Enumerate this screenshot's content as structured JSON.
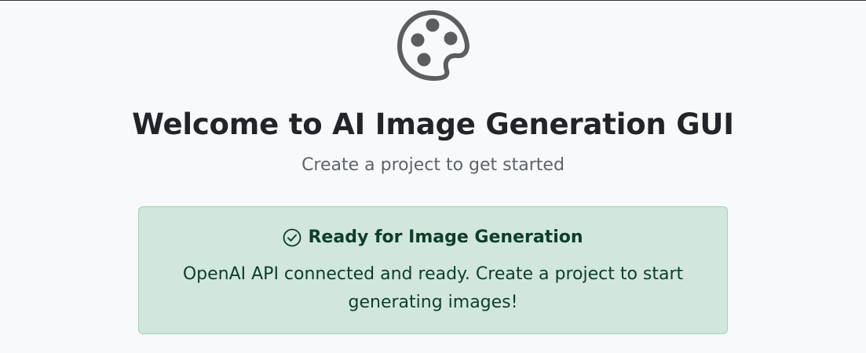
{
  "welcome": {
    "icon": "palette-icon",
    "title": "Welcome to AI Image Generation GUI",
    "subtitle": "Create a project to get started"
  },
  "status_alert": {
    "icon": "check-circle-icon",
    "heading": "Ready for Image Generation",
    "message": "OpenAI API connected and ready. Create a project to start generating images!",
    "background_color": "#d1e7dd",
    "text_color": "#0f3d29"
  }
}
